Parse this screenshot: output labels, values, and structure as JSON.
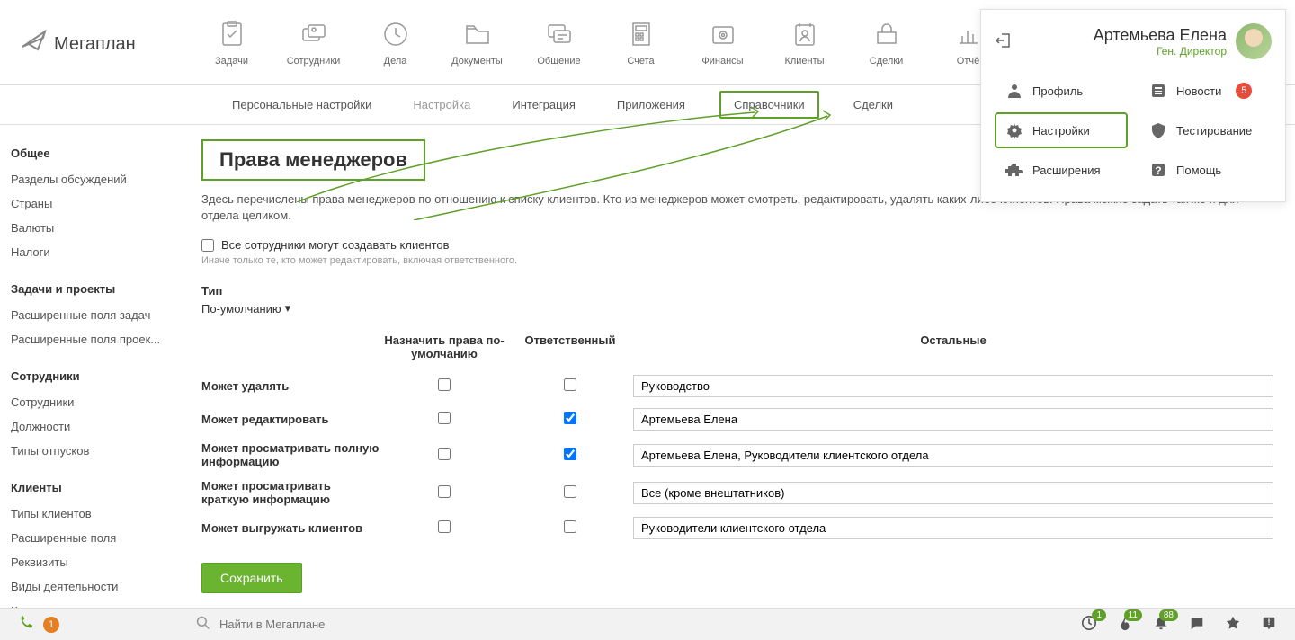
{
  "logo_text": "Мегаплан",
  "nav": [
    {
      "label": "Задачи"
    },
    {
      "label": "Сотрудники"
    },
    {
      "label": "Дела"
    },
    {
      "label": "Документы"
    },
    {
      "label": "Общение"
    },
    {
      "label": "Счета"
    },
    {
      "label": "Финансы"
    },
    {
      "label": "Клиенты"
    },
    {
      "label": "Сделки"
    },
    {
      "label": "Отчё"
    }
  ],
  "user": {
    "name": "Артемьева Елена",
    "role": "Ген. Директор"
  },
  "user_menu": {
    "profile": "Профиль",
    "news": "Новости",
    "news_count": "5",
    "settings": "Настройки",
    "testing": "Тестирование",
    "extensions": "Расширения",
    "help": "Помощь"
  },
  "subnav": [
    "Персональные настройки",
    "Настройка",
    "Интеграция",
    "Приложения",
    "Справочники",
    "Сделки"
  ],
  "sidebar": {
    "g1": "Общее",
    "g1_items": [
      "Разделы обсуждений",
      "Страны",
      "Валюты",
      "Налоги"
    ],
    "g2": "Задачи и проекты",
    "g2_items": [
      "Расширенные поля задач",
      "Расширенные поля проек..."
    ],
    "g3": "Сотрудники",
    "g3_items": [
      "Сотрудники",
      "Должности",
      "Типы отпусков"
    ],
    "g4": "Клиенты",
    "g4_items": [
      "Типы клиентов",
      "Расширенные поля",
      "Реквизиты",
      "Виды деятельности",
      "Каналы привлечения"
    ]
  },
  "page": {
    "title": "Права менеджеров",
    "desc": "Здесь перечислены права менеджеров по отношению к списку клиентов. Кто из менеджеров может смотреть, редактировать, удалять каких-либо клиентов. Права можно задать так же и для отдела целиком.",
    "checkbox_label": "Все сотрудники могут создавать клиентов",
    "hint": "Иначе только те, кто может редактировать, включая ответственного.",
    "type_label": "Тип",
    "type_value": "По-умолчанию",
    "col_def": "Назначить права по-умолчанию",
    "col_resp": "Ответственный",
    "col_others": "Остальные",
    "rows": [
      {
        "label": "Может удалять",
        "def": false,
        "resp": false,
        "others": "Руководство"
      },
      {
        "label": "Может редактировать",
        "def": false,
        "resp": true,
        "others": "Артемьева Елена"
      },
      {
        "label": "Может просматривать полную информацию",
        "def": false,
        "resp": true,
        "others": "Артемьева Елена, Руководители клиентского отдела"
      },
      {
        "label": "Может просматривать краткую информацию",
        "def": false,
        "resp": false,
        "others": "Все (кроме внештатников)"
      },
      {
        "label": "Может выгружать клиентов",
        "def": false,
        "resp": false,
        "others": "Руководители клиентского отдела"
      }
    ],
    "save": "Сохранить"
  },
  "footer": {
    "phone_badge": "1",
    "search_placeholder": "Найти в Мегаплане",
    "icons": [
      {
        "badge": "1"
      },
      {
        "badge": "11"
      },
      {
        "badge": "88"
      }
    ]
  }
}
